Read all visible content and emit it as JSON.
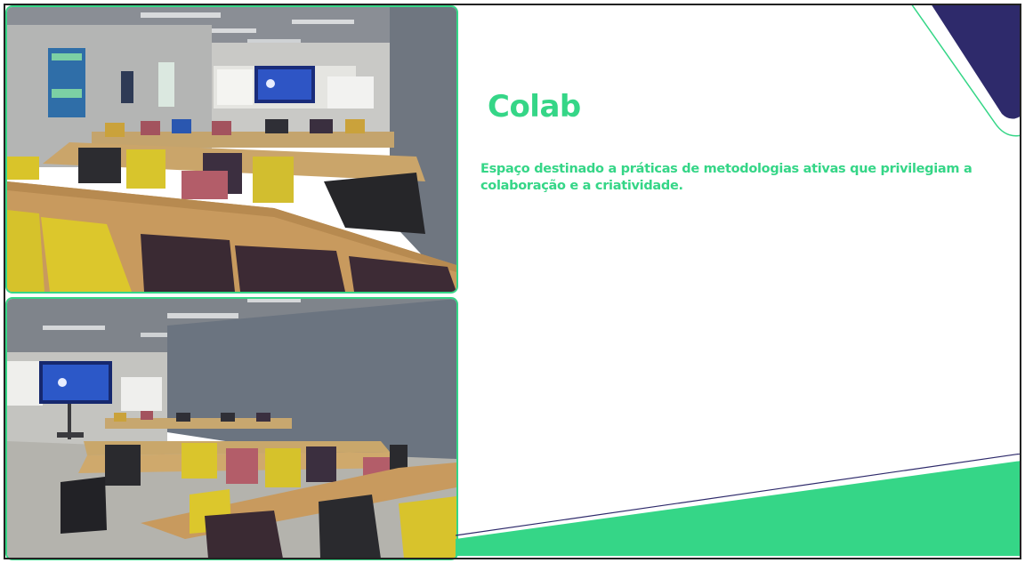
{
  "slide": {
    "title": "Colab",
    "description": "Espaço destinado a práticas de metodologias ativas que privilegiam a colaboração e a criatividade."
  },
  "colors": {
    "accent_green": "#35d687",
    "corner_navy": "#2e2a6b",
    "text_green": "#35d687"
  },
  "photos": [
    {
      "name": "classroom-photo-top"
    },
    {
      "name": "classroom-photo-bottom"
    }
  ]
}
